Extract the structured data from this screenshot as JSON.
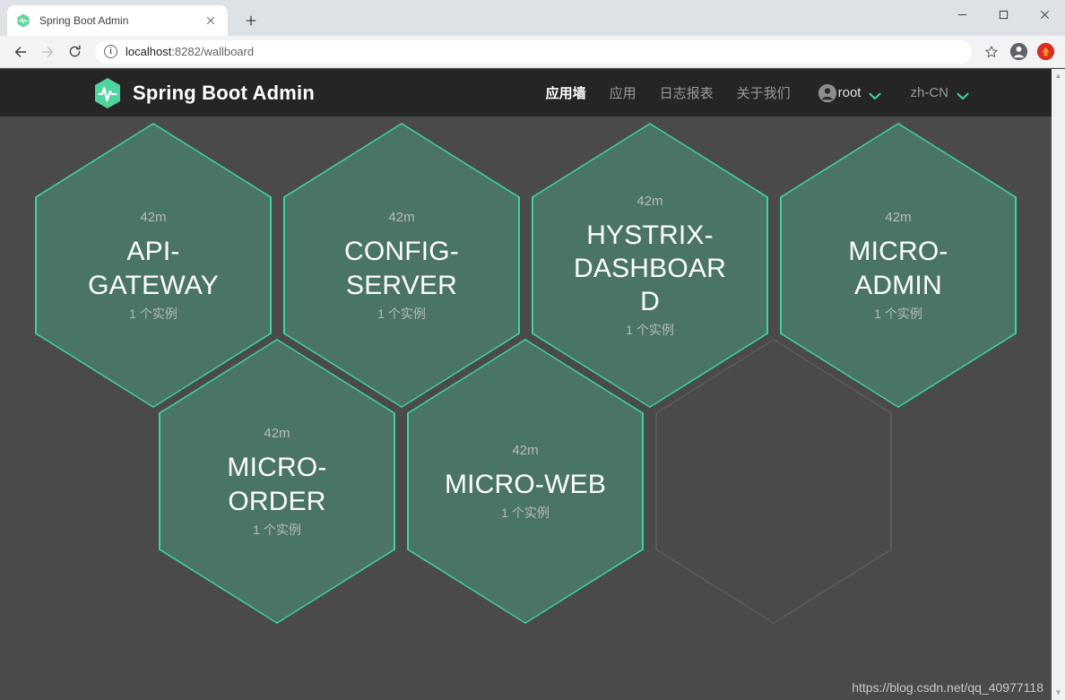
{
  "browser": {
    "tab": {
      "title": "Spring Boot Admin",
      "favicon_icon": "spring-boot-admin-logo-icon",
      "close_icon": "close-icon"
    },
    "new_tab_label": "+",
    "window_controls": {
      "minimize_icon": "minimize-icon",
      "maximize_icon": "maximize-icon",
      "close_icon": "close-icon"
    },
    "toolbar": {
      "back_icon": "back-arrow-icon",
      "forward_icon": "forward-arrow-icon",
      "reload_icon": "reload-icon",
      "site_info_icon": "info-circle-icon",
      "site_info_glyph": "i",
      "url_host": "localhost",
      "url_rest": ":8282/wallboard",
      "url_full": "localhost:8282/wallboard",
      "bookmark_icon": "star-icon",
      "profile_icon": "profile-avatar-icon",
      "extension_icon": "red-circle-arrow-icon"
    }
  },
  "app": {
    "brand": {
      "logo_icon": "spring-boot-admin-hex-pulse-icon",
      "title": "Spring Boot Admin"
    },
    "menu": [
      {
        "label": "应用墙",
        "name": "nav-wallboard",
        "active": true
      },
      {
        "label": "应用",
        "name": "nav-applications",
        "active": false
      },
      {
        "label": "日志报表",
        "name": "nav-journal",
        "active": false
      },
      {
        "label": "关于我们",
        "name": "nav-about",
        "active": false
      }
    ],
    "user": {
      "label": "root",
      "avatar_icon": "user-avatar-icon",
      "caret_icon": "chevron-down-icon"
    },
    "language": {
      "label": "zh-CN",
      "caret_icon": "chevron-down-icon"
    }
  },
  "colors": {
    "accent_green": "#3fd39b",
    "hex_fill": "#4a7566",
    "page_background": "#4a4a4a",
    "navbar_background": "#252525",
    "empty_hex_border": "#5b5b5b"
  },
  "wallboard": {
    "applications": [
      {
        "name": "API-GATEWAY",
        "uptime": "42m",
        "instances": "1 个实例"
      },
      {
        "name": "CONFIG-SERVER",
        "uptime": "42m",
        "instances": "1 个实例"
      },
      {
        "name": "HYSTRIX-DASHBOARD",
        "uptime": "42m",
        "instances": "1 个实例"
      },
      {
        "name": "MICRO-ADMIN",
        "uptime": "42m",
        "instances": "1 个实例"
      },
      {
        "name": "MICRO-ORDER",
        "uptime": "42m",
        "instances": "1 个实例"
      },
      {
        "name": "MICRO-WEB",
        "uptime": "42m",
        "instances": "1 个实例"
      }
    ],
    "empty_slot_count": 1
  },
  "watermark": "https://blog.csdn.net/qq_40977118",
  "scrollbar": {
    "up_arrow_icon": "scroll-up-arrow-icon",
    "down_arrow_icon": "scroll-down-arrow-icon"
  }
}
